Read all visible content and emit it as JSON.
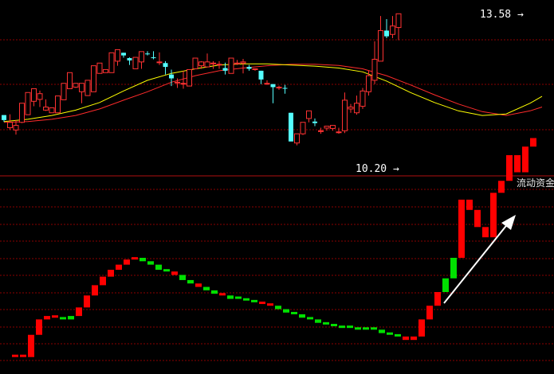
{
  "chart_data": [
    {
      "type": "candlestick",
      "title": "",
      "price_range": [
        9.4,
        14.0
      ],
      "annotations": {
        "high_label": "13.58",
        "low_label": "10.20"
      },
      "ohlc": [
        [
          10.99,
          10.99,
          10.86,
          10.81
        ],
        [
          10.66,
          11.01,
          10.8,
          10.6
        ],
        [
          10.6,
          10.86,
          10.72,
          10.48
        ],
        [
          10.8,
          10.99,
          11.3,
          10.78
        ],
        [
          11.0,
          11.1,
          11.58,
          11.43
        ],
        [
          11.35,
          11.5,
          11.68,
          11.22
        ],
        [
          11.4,
          11.63,
          11.55,
          11.2
        ],
        [
          11.12,
          11.4,
          11.2,
          11.1
        ],
        [
          11.05,
          11.12,
          11.18,
          11.15
        ],
        [
          11.05,
          11.16,
          11.49,
          11.4
        ],
        [
          11.39,
          11.68,
          11.82,
          11.4
        ],
        [
          11.68,
          11.7,
          12.1,
          11.9
        ],
        [
          11.72,
          11.75,
          11.82,
          11.7
        ],
        [
          11.6,
          11.66,
          11.82,
          11.3
        ],
        [
          11.5,
          11.65,
          11.9,
          11.52
        ],
        [
          11.6,
          11.6,
          12.28,
          12.12
        ],
        [
          12.08,
          12.32,
          12.35,
          12.1
        ],
        [
          12.1,
          12.15,
          12.18,
          12.1
        ],
        [
          12.1,
          12.16,
          12.62,
          12.46
        ],
        [
          12.4,
          12.7,
          12.7,
          12.28
        ],
        [
          12.62,
          12.62,
          12.55,
          12.49
        ],
        [
          12.48,
          12.5,
          12.42,
          12.3
        ],
        [
          12.2,
          12.38,
          12.5,
          12.2
        ],
        [
          12.38,
          12.62,
          12.65,
          12.2
        ],
        [
          12.6,
          12.66,
          12.58,
          12.55
        ],
        [
          12.5,
          12.66,
          12.48,
          12.45
        ],
        [
          12.36,
          12.63,
          12.38,
          12.3
        ],
        [
          12.35,
          12.4,
          12.25,
          12.05
        ],
        [
          12.05,
          12.18,
          11.95,
          11.75
        ],
        [
          11.85,
          11.95,
          11.85,
          11.7
        ],
        [
          11.82,
          12.15,
          11.82,
          11.68
        ],
        [
          11.75,
          12.18,
          12.18,
          11.8
        ],
        [
          12.2,
          12.46,
          12.48,
          12.2
        ],
        [
          12.28,
          12.4,
          12.38,
          12.2
        ],
        [
          12.25,
          12.6,
          12.38,
          12.3
        ],
        [
          12.35,
          12.4,
          12.35,
          12.2
        ],
        [
          12.3,
          12.4,
          12.32,
          12.2
        ],
        [
          12.22,
          12.36,
          12.15,
          12.05
        ],
        [
          12.08,
          12.4,
          12.48,
          12.1
        ],
        [
          12.35,
          12.43,
          12.35,
          12.3
        ],
        [
          12.35,
          12.46,
          12.38,
          12.08
        ],
        [
          12.25,
          12.3,
          12.2,
          12.15
        ],
        [
          12.2,
          12.2,
          12.2,
          12.15
        ],
        [
          12.15,
          12.15,
          11.92,
          11.8
        ],
        [
          11.82,
          11.9,
          11.82,
          11.78
        ],
        [
          11.8,
          11.75,
          11.72,
          11.3
        ],
        [
          11.7,
          11.76,
          11.72,
          11.65
        ],
        [
          11.7,
          11.78,
          11.68,
          11.55
        ],
        [
          11.05,
          11.05,
          10.3,
          10.3
        ],
        [
          10.26,
          10.45,
          10.5,
          10.2
        ],
        [
          10.5,
          10.55,
          10.8,
          10.47
        ],
        [
          10.9,
          11.1,
          11.1,
          10.8
        ],
        [
          10.82,
          10.9,
          10.78,
          10.7
        ],
        [
          10.58,
          10.66,
          10.58,
          10.5
        ],
        [
          10.65,
          10.7,
          10.7,
          10.58
        ],
        [
          10.64,
          10.7,
          10.72,
          10.58
        ],
        [
          10.55,
          10.66,
          10.55,
          10.5
        ],
        [
          10.58,
          11.58,
          11.38,
          10.52
        ],
        [
          11.15,
          11.28,
          11.2,
          11.05
        ],
        [
          11.05,
          11.5,
          11.3,
          11.0
        ],
        [
          11.22,
          11.7,
          11.62,
          11.15
        ],
        [
          11.6,
          12.15,
          12.02,
          11.5
        ],
        [
          11.9,
          12.92,
          12.45,
          11.8
        ],
        [
          12.4,
          13.58,
          13.2,
          12.4
        ],
        [
          13.2,
          13.5,
          13.05,
          13.0
        ],
        [
          13.1,
          13.58,
          13.32,
          13.0
        ],
        [
          13.28,
          13.58,
          13.64,
          12.95
        ]
      ],
      "ma_short": [
        [
          0,
          10.82
        ],
        [
          4,
          10.88
        ],
        [
          8,
          10.98
        ],
        [
          12,
          11.12
        ],
        [
          16,
          11.32
        ],
        [
          20,
          11.62
        ],
        [
          24,
          11.9
        ],
        [
          28,
          12.08
        ],
        [
          32,
          12.2
        ],
        [
          36,
          12.3
        ],
        [
          40,
          12.33
        ],
        [
          44,
          12.33
        ],
        [
          48,
          12.3
        ],
        [
          52,
          12.27
        ],
        [
          56,
          12.22
        ],
        [
          60,
          12.12
        ],
        [
          64,
          11.88
        ],
        [
          68,
          11.58
        ],
        [
          72,
          11.32
        ],
        [
          76,
          11.1
        ],
        [
          80,
          10.98
        ],
        [
          84,
          11.02
        ],
        [
          88,
          11.3
        ],
        [
          90,
          11.48
        ]
      ],
      "ma_long": [
        [
          0,
          10.8
        ],
        [
          4,
          10.82
        ],
        [
          8,
          10.88
        ],
        [
          12,
          10.98
        ],
        [
          16,
          11.15
        ],
        [
          20,
          11.38
        ],
        [
          24,
          11.6
        ],
        [
          28,
          11.85
        ],
        [
          32,
          12.02
        ],
        [
          36,
          12.15
        ],
        [
          40,
          12.22
        ],
        [
          44,
          12.28
        ],
        [
          48,
          12.32
        ],
        [
          52,
          12.32
        ],
        [
          56,
          12.29
        ],
        [
          60,
          12.2
        ],
        [
          64,
          12.02
        ],
        [
          68,
          11.78
        ],
        [
          72,
          11.52
        ],
        [
          76,
          11.28
        ],
        [
          80,
          11.08
        ],
        [
          84,
          10.98
        ],
        [
          88,
          11.1
        ],
        [
          90,
          11.2
        ]
      ],
      "colors": {
        "up": "#ff3232",
        "down": "#54ffff",
        "ma_short": "#ffff00",
        "ma_long": "#ff2b2b",
        "grid": "#8b0000"
      }
    },
    {
      "type": "bar",
      "title": "流动资金",
      "ylim": [
        0,
        100
      ],
      "values": [
        2,
        2,
        2,
        15,
        24,
        26,
        25,
        24,
        26,
        31,
        38,
        44,
        49,
        53,
        56,
        59,
        60,
        58,
        56,
        53,
        52,
        50,
        47,
        45,
        43,
        41,
        39,
        38,
        36,
        36,
        35,
        34,
        33,
        32,
        30,
        28,
        27,
        25,
        24,
        22,
        21,
        20,
        19,
        19,
        18,
        18,
        18,
        16,
        15,
        14,
        12,
        14,
        24,
        32,
        40,
        48,
        60,
        94,
        88,
        78,
        72,
        98,
        105,
        120,
        110,
        125,
        130
      ],
      "up_flags": [
        1,
        1,
        1,
        1,
        1,
        1,
        1,
        0,
        0,
        1,
        1,
        1,
        1,
        1,
        1,
        1,
        1,
        0,
        0,
        0,
        0,
        1,
        0,
        0,
        1,
        0,
        0,
        1,
        0,
        0,
        0,
        0,
        1,
        1,
        0,
        0,
        0,
        0,
        0,
        0,
        0,
        0,
        0,
        0,
        0,
        0,
        0,
        0,
        0,
        0,
        1,
        1,
        1,
        1,
        1,
        0,
        0,
        1,
        1,
        1,
        1,
        1,
        1,
        1,
        1,
        1,
        1
      ],
      "colors": {
        "up": "#ff0000",
        "down": "#00e000",
        "grid": "#8b0000",
        "arrow": "#ffffff"
      }
    }
  ]
}
